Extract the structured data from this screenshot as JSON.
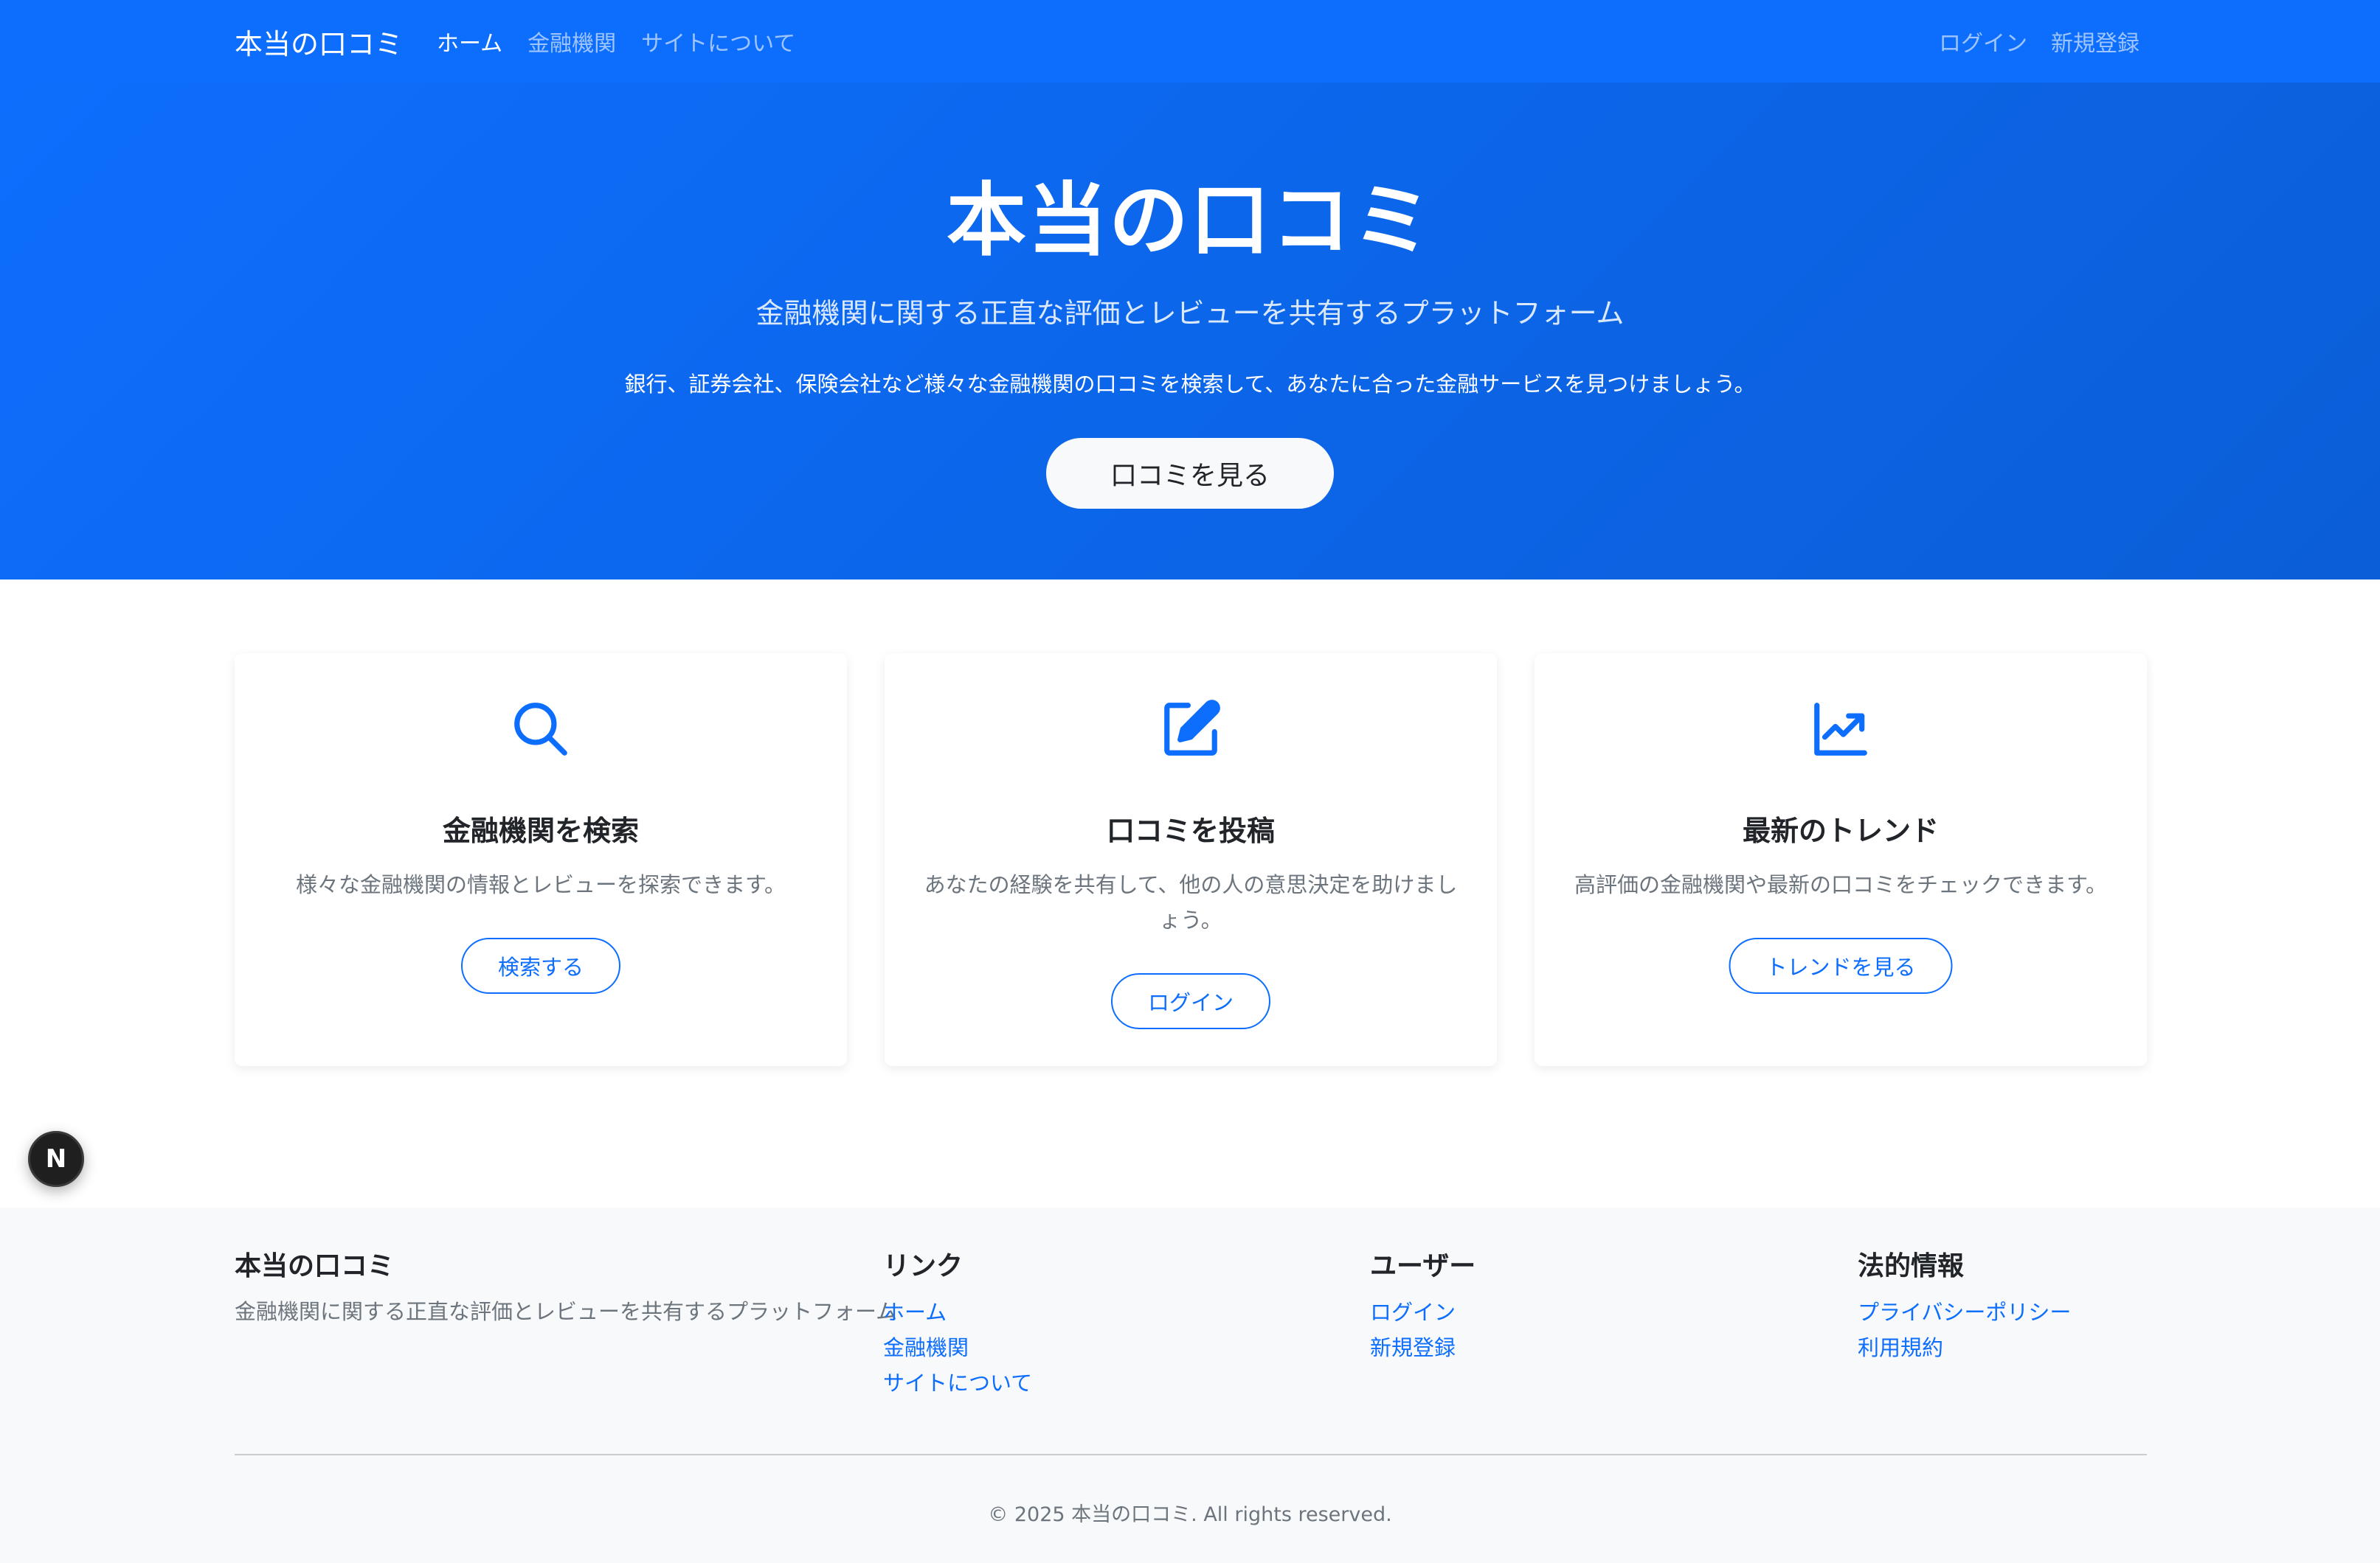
{
  "navbar": {
    "brand": "本当の口コミ",
    "links": [
      "ホーム",
      "金融機関",
      "サイトについて"
    ],
    "login": "ログイン",
    "signup": "新規登録"
  },
  "hero": {
    "title": "本当の口コミ",
    "subtitle": "金融機関に関する正直な評価とレビューを共有するプラットフォーム",
    "description": "銀行、証券会社、保険会社など様々な金融機関の口コミを検索して、あなたに合った金融サービスを見つけましょう。",
    "button": "口コミを見る"
  },
  "features": [
    {
      "icon": "search-icon",
      "title": "金融機関を検索",
      "text": "様々な金融機関の情報とレビューを探索できます。",
      "button": "検索する"
    },
    {
      "icon": "edit-icon",
      "title": "口コミを投稿",
      "text": "あなたの経験を共有して、他の人の意思決定を助けましょう。",
      "button": "ログイン"
    },
    {
      "icon": "trend-chart-icon",
      "title": "最新のトレンド",
      "text": "高評価の金融機関や最新の口コミをチェックできます。",
      "button": "トレンドを見る"
    }
  ],
  "next_badge": "N",
  "footer": {
    "brand": {
      "title": "本当の口コミ",
      "text": "金融機関に関する正直な評価とレビューを共有するプラットフォーム"
    },
    "links": {
      "title": "リンク",
      "items": [
        "ホーム",
        "金融機関",
        "サイトについて"
      ]
    },
    "user": {
      "title": "ユーザー",
      "items": [
        "ログイン",
        "新規登録"
      ]
    },
    "legal": {
      "title": "法的情報",
      "items": [
        "プライバシーポリシー",
        "利用規約"
      ]
    },
    "copyright": "© 2025 本当の口コミ. All rights reserved."
  },
  "colors": {
    "primary": "#0d6efd",
    "hero_end": "#0b5ed7",
    "footer_bg": "#f8f9fa",
    "muted_text": "#6c757d"
  }
}
